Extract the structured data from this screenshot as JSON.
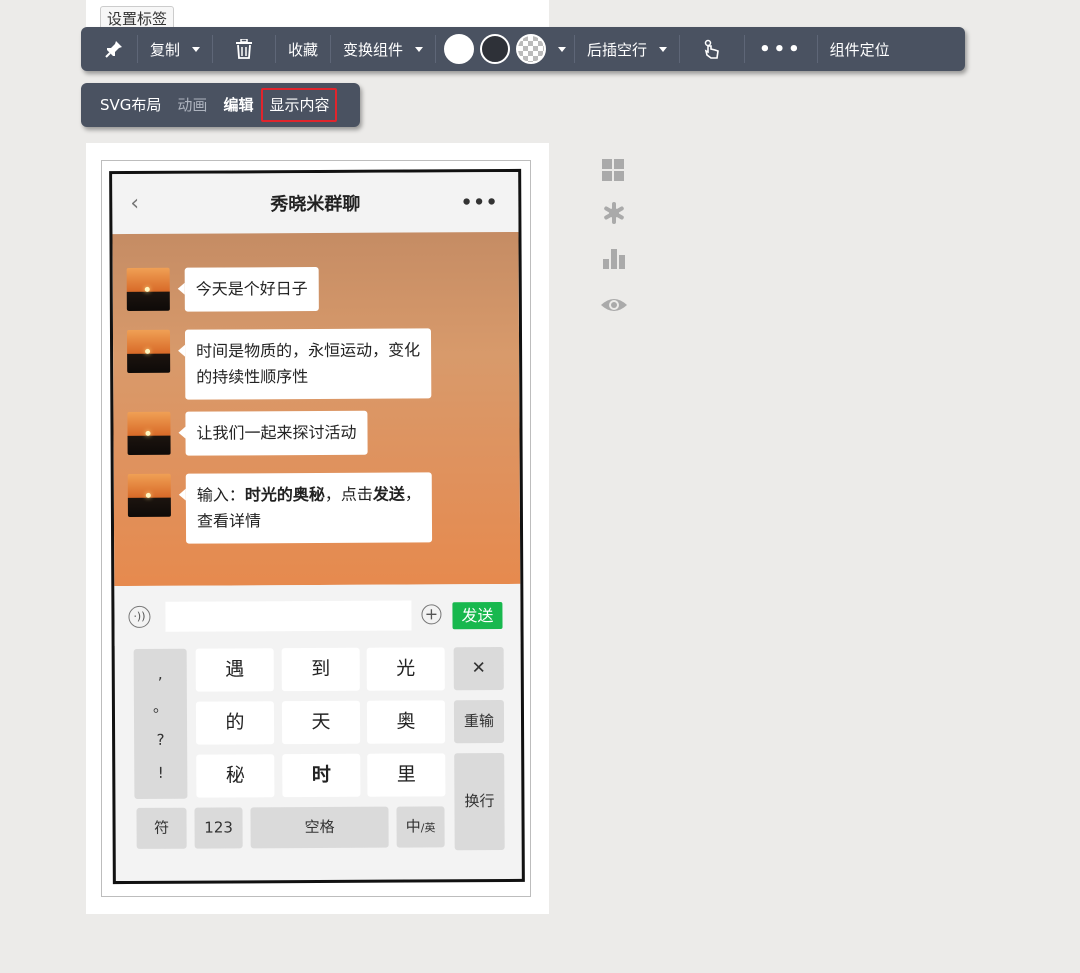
{
  "top_tag_button": "设置标签",
  "toolbar": {
    "copy": "复制",
    "favorite": "收藏",
    "transform": "变换组件",
    "insert_row_after": "后插空行",
    "more": "•••",
    "locate": "组件定位",
    "colors": {
      "white": "#ffffff",
      "dark": "#2e3138",
      "bar_bg": "#4a5261"
    }
  },
  "subtoolbar": {
    "svg_layout": "SVG布局",
    "animation": "动画",
    "edit": "编辑",
    "show_content": "显示内容"
  },
  "phone": {
    "back": "‹",
    "title": "秀晓米群聊",
    "more": "•••",
    "messages": [
      {
        "text": "今天是个好日子"
      },
      {
        "line1": "时间是物质的，永恒运动，变化",
        "line2": "的持续性顺序性"
      },
      {
        "text": "让我们一起来探讨活动"
      },
      {
        "p1": "输入：",
        "b1": "时光的奥秘",
        "p2": "，点击",
        "b2": "发送",
        "p3": "，",
        "line2": "查看详情"
      }
    ],
    "input_value": "",
    "send": "发送",
    "keyboard": {
      "punct": [
        ",",
        "。",
        "?",
        "!"
      ],
      "rows": [
        [
          "遇",
          "到",
          "光"
        ],
        [
          "的",
          "天",
          "奥"
        ],
        [
          "秘",
          "时",
          "里"
        ]
      ],
      "delete": "✕",
      "reinput": "重输",
      "newline": "换行",
      "symbol": "符",
      "numbers": "123",
      "space": "空格",
      "lang_main": "中",
      "lang_sub": "/英"
    }
  }
}
